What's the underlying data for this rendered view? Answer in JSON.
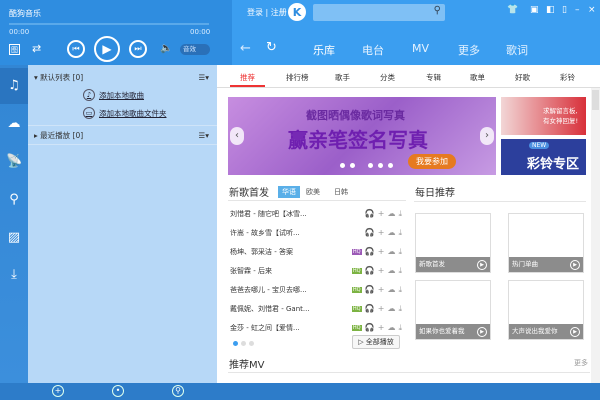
{
  "app": {
    "title": "酷狗音乐",
    "time_current": "00:00",
    "time_total": "00:00",
    "sound_toggle": "音效",
    "login": "登录 | 注册",
    "logo": "K",
    "search_placeholder": ""
  },
  "nav": [
    "乐库",
    "电台",
    "MV",
    "更多",
    "歌词"
  ],
  "sidebar_icons": [
    "music-note-icon",
    "cloud-icon",
    "radio-icon",
    "location-icon",
    "image-icon",
    "download-icon"
  ],
  "playlist": {
    "default": "默认列表 [0]",
    "add_song": "添加本地歌曲",
    "add_folder": "添加本地歌曲文件夹",
    "recent": "最近播放 [0]"
  },
  "tabs": [
    "推荐",
    "排行榜",
    "歌手",
    "分类",
    "专辑",
    "歌单",
    "好歌",
    "彩铃"
  ],
  "banner": {
    "line1": "截图晒偶像歌词写真",
    "line2": "赢亲笔签名写真",
    "button": "我要参加",
    "promo1": "求解留言板,有女神回复!",
    "promo2_badge": "NEW",
    "promo2": "彩铃专区"
  },
  "new_songs": {
    "title": "新歌首发",
    "filters": [
      "华语",
      "欧美",
      "日韩"
    ],
    "play_all": "全部播放",
    "songs": [
      {
        "name": "刘惜君 - 随它吧【冰雪...",
        "hq": ""
      },
      {
        "name": "许嵩 - 故乡雪【试听...",
        "hq": ""
      },
      {
        "name": "杨坤、郭采洁 - 答案",
        "hq": "purple"
      },
      {
        "name": "张智霖 - 后来",
        "hq": "green"
      },
      {
        "name": "爸爸去哪儿 - 宝贝去哪...",
        "hq": "green"
      },
      {
        "name": "戴佩妮、刘惜君 - Gant...",
        "hq": "green"
      },
      {
        "name": "金莎 - 虹之间【爱情...",
        "hq": "green"
      }
    ]
  },
  "daily": {
    "title": "每日推荐",
    "cards": [
      "新歌首发",
      "热门单曲",
      "如果你也爱着我",
      "大声说出我爱你"
    ],
    "more": "更多"
  },
  "mv": {
    "title": "推荐MV"
  },
  "colors": {
    "accent": "#3b9ef0",
    "hq_green": "#7cb342",
    "hq_purple": "#9b59b6",
    "active_tab": "#e33333"
  }
}
